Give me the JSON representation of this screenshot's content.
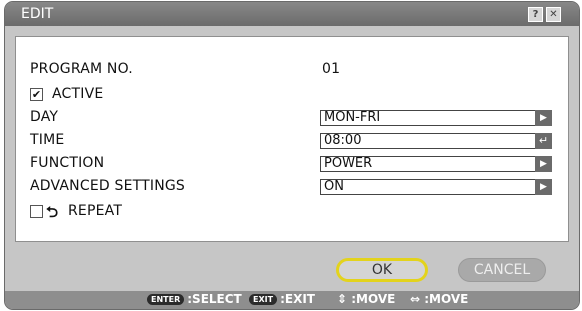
{
  "window": {
    "title": "EDIT",
    "help_label": "?",
    "close_label": "✕"
  },
  "form": {
    "program_no_label": "PROGRAM NO.",
    "program_no_value": "01",
    "active_label": "ACTIVE",
    "active_checked": true,
    "day_label": "DAY",
    "day_value": "MON-FRI",
    "time_label": "TIME",
    "time_value": "08:00",
    "function_label": "FUNCTION",
    "function_value": "POWER",
    "advanced_label": "ADVANCED SETTINGS",
    "advanced_value": "ON",
    "repeat_label": "REPEAT",
    "repeat_checked": false
  },
  "buttons": {
    "ok_label": "OK",
    "cancel_label": "CANCEL"
  },
  "statusbar": {
    "enter_key": "ENTER",
    "select": ":SELECT",
    "exit_key": "EXIT",
    "exit": ":EXIT",
    "move_vertical": ":MOVE",
    "move_horizontal": ":MOVE"
  },
  "colors": {
    "ok_border": "#e3d31c",
    "panel_bg": "#ffffff",
    "frame_bg": "#c6c6c6"
  },
  "icons": {
    "arrow": "play-right-icon",
    "enter": "enter-return-icon",
    "repeat": "repeat-icon"
  }
}
